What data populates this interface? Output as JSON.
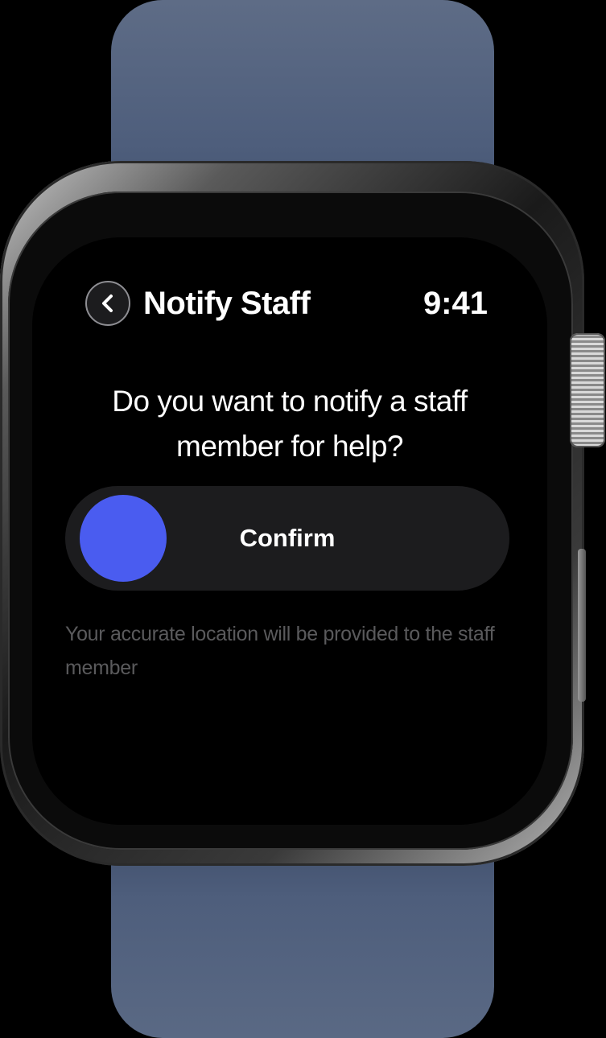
{
  "header": {
    "back_icon": "chevron-left-icon",
    "title": "Notify Staff",
    "time": "9:41"
  },
  "main": {
    "question": "Do you want to notify a staff member for help?",
    "slider": {
      "label": "Confirm",
      "knob_color": "#4a5cf0"
    },
    "note": "Your accurate location will be provided to the staff member"
  },
  "colors": {
    "accent": "#4a5cf0",
    "background": "#000000",
    "note_text": "#5a5a5c"
  }
}
